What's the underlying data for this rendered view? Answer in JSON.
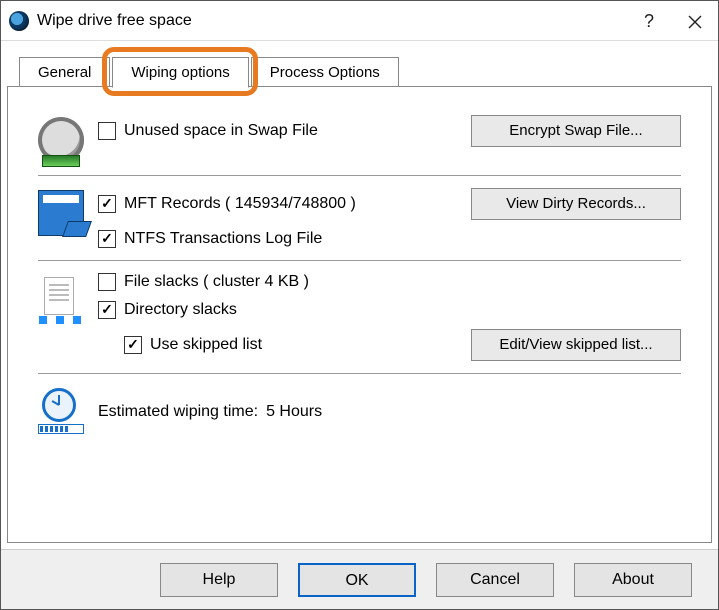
{
  "window": {
    "title": "Wipe drive free space",
    "help_glyph": "?",
    "close_glyph": "×"
  },
  "tabs": {
    "general": "General",
    "wiping": "Wiping options",
    "process": "Process Options",
    "active_index": 1
  },
  "swap": {
    "checkbox_label": "Unused space in Swap File",
    "checked": false,
    "button": "Encrypt Swap File..."
  },
  "mft": {
    "records_label": "MFT Records ( 145934/748800 )",
    "records_checked": true,
    "ntfs_label": "NTFS Transactions Log File",
    "ntfs_checked": true,
    "button": "View Dirty Records..."
  },
  "slacks": {
    "file_label": "File slacks ( cluster 4 KB )",
    "file_checked": false,
    "dir_label": "Directory slacks",
    "dir_checked": true,
    "skipped_label": "Use skipped list",
    "skipped_checked": true,
    "button": "Edit/View skipped list..."
  },
  "estimate": {
    "label": "Estimated wiping time:",
    "value": "5 Hours"
  },
  "buttons": {
    "help": "Help",
    "ok": "OK",
    "cancel": "Cancel",
    "about": "About"
  }
}
